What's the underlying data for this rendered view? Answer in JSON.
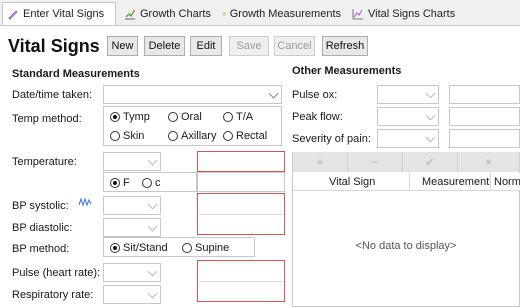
{
  "tabs": [
    {
      "label": "Enter Vital Signs",
      "icon": "pencil-icon",
      "active": true
    },
    {
      "label": "Growth Charts",
      "icon": "chart-icon",
      "active": false
    },
    {
      "label": "Growth Measurements",
      "icon": "calendar-icon",
      "active": false
    },
    {
      "label": "Vital Signs Charts",
      "icon": "line-chart-icon",
      "active": false
    }
  ],
  "header": {
    "title": "Vital Signs",
    "buttons": {
      "new": "New",
      "delete": "Delete",
      "edit": "Edit",
      "save": "Save",
      "cancel": "Cancel",
      "refresh": "Refresh"
    }
  },
  "standard": {
    "section_title": "Standard Measurements",
    "date_label": "Date/time taken:",
    "temp_method_label": "Temp method:",
    "temp_methods": [
      "Tymp",
      "Oral",
      "T/A",
      "Skin",
      "Axillary",
      "Rectal"
    ],
    "temp_method_selected": "Tymp",
    "temperature_label": "Temperature:",
    "temp_units": [
      "F",
      "c"
    ],
    "temp_unit_selected": "F",
    "bp_systolic_label": "BP systolic:",
    "bp_diastolic_label": "BP diastolic:",
    "bp_method_label": "BP method:",
    "bp_methods": [
      "Sit/Stand",
      "Supine"
    ],
    "bp_method_selected": "Sit/Stand",
    "pulse_label": "Pulse (heart rate):",
    "resp_label": "Respiratory rate:"
  },
  "other": {
    "section_title": "Other Measurements",
    "pulse_ox_label": "Pulse ox:",
    "peak_flow_label": "Peak flow:",
    "pain_label": "Severity of pain:"
  },
  "grid": {
    "toolbar": [
      "+",
      "−",
      "✓",
      "×"
    ],
    "columns": [
      "Vital Sign",
      "Measurement",
      "Norm"
    ],
    "empty_text": "<No data to display>"
  },
  "colors": {
    "highlight": "#d9534f",
    "accent": "#4a7bd0"
  }
}
